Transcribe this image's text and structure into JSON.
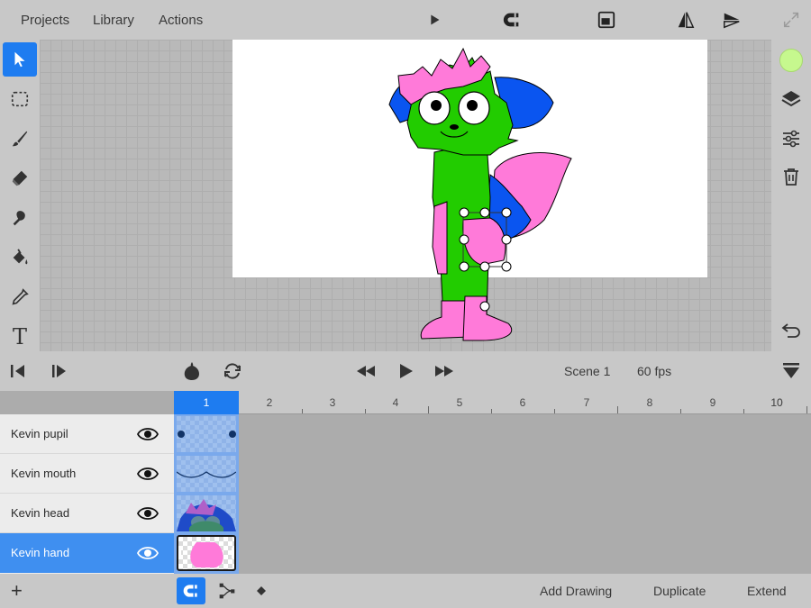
{
  "menu": {
    "projects": "Projects",
    "library": "Library",
    "actions": "Actions"
  },
  "icons": {
    "play_preview": "play-triangle-icon",
    "magnet": "magnet-icon",
    "frame": "frame-icon",
    "flip_h": "flip-horizontal-icon",
    "flip_v": "flip-vertical-icon",
    "expand": "expand-icon"
  },
  "tools": [
    "select-arrow",
    "marquee-select",
    "brush",
    "eraser",
    "smudge",
    "paint-bucket",
    "eyedropper",
    "text"
  ],
  "text_tool_label": "T",
  "right_tools": {
    "current_color": "#c6f88e",
    "items": [
      "layers",
      "adjustments",
      "trash",
      "undo",
      "collapse"
    ]
  },
  "playback": {
    "scene": "Scene 1",
    "fps": "60 fps"
  },
  "timeline": {
    "frames": [
      "1",
      "2",
      "3",
      "4",
      "5",
      "6",
      "7",
      "8",
      "9",
      "10"
    ],
    "current_frame": "1",
    "layers": [
      {
        "name": "Kevin pupil",
        "visible": true,
        "selected": false
      },
      {
        "name": "Kevin mouth",
        "visible": true,
        "selected": false
      },
      {
        "name": "Kevin head",
        "visible": true,
        "selected": false
      },
      {
        "name": "Kevin hand",
        "visible": true,
        "selected": true
      }
    ]
  },
  "bottom": {
    "add_layer": "+",
    "add_drawing": "Add Drawing",
    "duplicate": "Duplicate",
    "extend": "Extend"
  },
  "colors": {
    "accent": "#1e7cf0",
    "green": "#22cc00",
    "pink": "#ff7ad9",
    "blue": "#0a55f0"
  }
}
